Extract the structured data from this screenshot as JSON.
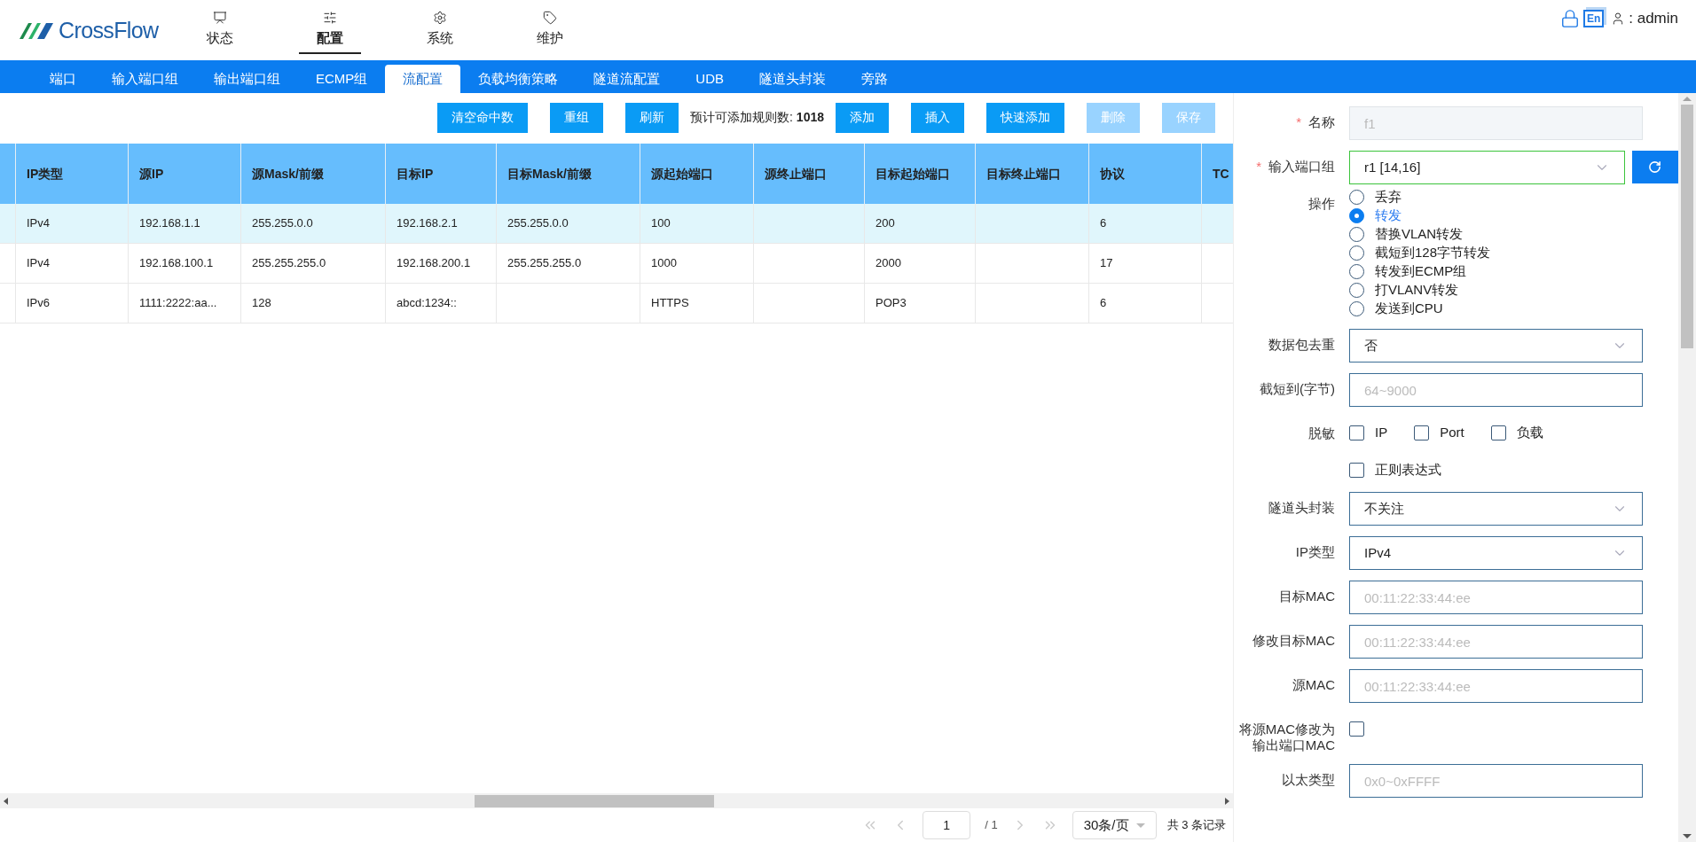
{
  "header": {
    "logo": "CrossFlow",
    "nav": [
      {
        "kind": "monitor",
        "label": "状态",
        "selected": false
      },
      {
        "kind": "sliders",
        "label": "配置",
        "selected": true
      },
      {
        "kind": "gear",
        "label": "系统",
        "selected": false
      },
      {
        "kind": "tag",
        "label": "维护",
        "selected": false
      }
    ],
    "lang": "En",
    "user": ": admin"
  },
  "tabs": [
    {
      "label": "端口",
      "selected": false
    },
    {
      "label": "输入端口组",
      "selected": false
    },
    {
      "label": "输出端口组",
      "selected": false
    },
    {
      "label": "ECMP组",
      "selected": false
    },
    {
      "label": "流配置",
      "selected": true
    },
    {
      "label": "负载均衡策略",
      "selected": false
    },
    {
      "label": "隧道流配置",
      "selected": false
    },
    {
      "label": "UDB",
      "selected": false
    },
    {
      "label": "隧道头封装",
      "selected": false
    },
    {
      "label": "旁路",
      "selected": false
    }
  ],
  "toolbar": [
    {
      "kind": "button",
      "label": "清空命中数",
      "disabled": false
    },
    {
      "kind": "button",
      "label": "重组",
      "disabled": false
    },
    {
      "kind": "button",
      "label": "刷新",
      "disabled": false
    },
    {
      "kind": "text",
      "label": "预计可添加规则数: **1018**"
    },
    {
      "kind": "button",
      "label": "添加",
      "disabled": false
    },
    {
      "kind": "button",
      "label": "插入",
      "disabled": false
    },
    {
      "kind": "button",
      "label": "快速添加",
      "disabled": false
    },
    {
      "kind": "button",
      "label": "删除",
      "disabled": true
    },
    {
      "kind": "button",
      "label": "保存",
      "disabled": true
    }
  ],
  "table": {
    "columns": [
      "IP类型",
      "源IP",
      "源Mask/前缀",
      "目标IP",
      "目标Mask/前缀",
      "源起始端口",
      "源终止端口",
      "目标起始端口",
      "目标终止端口",
      "协议",
      "TC"
    ],
    "rows": [
      {
        "selected": true,
        "cells": [
          "IPv4",
          "192.168.1.1",
          "255.255.0.0",
          "192.168.2.1",
          "255.255.0.0",
          "100",
          "",
          "200",
          "",
          "6",
          ""
        ]
      },
      {
        "selected": false,
        "cells": [
          "IPv4",
          "192.168.100.1",
          "255.255.255.0",
          "192.168.200.1",
          "255.255.255.0",
          "1000",
          "",
          "2000",
          "",
          "17",
          ""
        ]
      },
      {
        "selected": false,
        "cells": [
          "IPv6",
          "1111:2222:aa...",
          "128",
          "abcd:1234::",
          "",
          "HTTPS",
          "",
          "POP3",
          "",
          "6",
          ""
        ]
      }
    ]
  },
  "pagination": {
    "page": "1",
    "total_pages": "/ 1",
    "page_size": "30条/页",
    "summary": "共 3 条记录"
  },
  "form": {
    "fields": [
      {
        "kind": "text",
        "label": "名称",
        "required_mark": "*",
        "value": "f1",
        "disabled": true
      },
      {
        "kind": "select_refresh",
        "label": "输入端口组",
        "required_mark": "*",
        "value": "r1 [14,16]",
        "highlighted": true
      },
      {
        "kind": "radio",
        "label": "操作",
        "options": [
          {
            "label": "丢弃",
            "selected": false
          },
          {
            "label": "转发",
            "selected": true
          },
          {
            "label": "替换VLAN转发",
            "selected": false
          },
          {
            "label": "截短到128字节转发",
            "selected": false
          },
          {
            "label": "转发到ECMP组",
            "selected": false
          },
          {
            "label": "打VLANV转发",
            "selected": false
          },
          {
            "label": "发送到CPU",
            "selected": false
          }
        ]
      },
      {
        "kind": "select",
        "label": "数据包去重",
        "value": "否",
        "highlighted": false
      },
      {
        "kind": "input",
        "label": "截短到(字节)",
        "placeholder": "64~9000"
      },
      {
        "kind": "checks",
        "label": "脱敏",
        "options": [
          {
            "label": "IP",
            "checked": false
          },
          {
            "label": "Port",
            "checked": false
          },
          {
            "label": "负载",
            "checked": false
          }
        ]
      },
      {
        "kind": "checks",
        "options": [
          {
            "label": "正则表达式",
            "checked": false
          }
        ]
      },
      {
        "kind": "select",
        "label": "隧道头封装",
        "value": "不关注",
        "highlighted": false
      },
      {
        "kind": "select",
        "label": "IP类型",
        "value": "IPv4",
        "highlighted": false
      },
      {
        "kind": "input",
        "label": "目标MAC",
        "placeholder": "00:11:22:33:44:ee"
      },
      {
        "kind": "input",
        "label": "修改目标MAC",
        "placeholder": "00:11:22:33:44:ee"
      },
      {
        "kind": "input",
        "label": "源MAC",
        "placeholder": "00:11:22:33:44:ee"
      },
      {
        "kind": "checkbox",
        "label": "将源MAC修改为输出端口MAC",
        "checked": false
      },
      {
        "kind": "input",
        "label": "以太类型",
        "placeholder": "0x0~0xFFFF"
      }
    ]
  }
}
